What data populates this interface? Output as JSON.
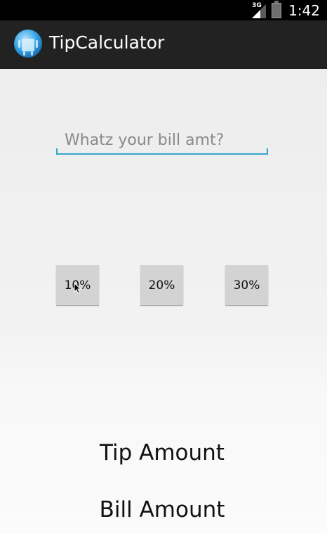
{
  "status_bar": {
    "network_label": "3G",
    "time": "1:42"
  },
  "action_bar": {
    "title": "TipCalculator",
    "icon": "android-app-icon"
  },
  "bill_input": {
    "value": "",
    "placeholder": "Whatz your bill amt?"
  },
  "tip_buttons": [
    {
      "label": "10%"
    },
    {
      "label": "20%"
    },
    {
      "label": "30%"
    }
  ],
  "results": {
    "tip_amount_label": "Tip Amount",
    "bill_amount_label": "Bill Amount"
  },
  "colors": {
    "status_bar": "#000000",
    "action_bar": "#222222",
    "input_underline": "#33a6cc",
    "button_bg": "#d3d3d3"
  }
}
